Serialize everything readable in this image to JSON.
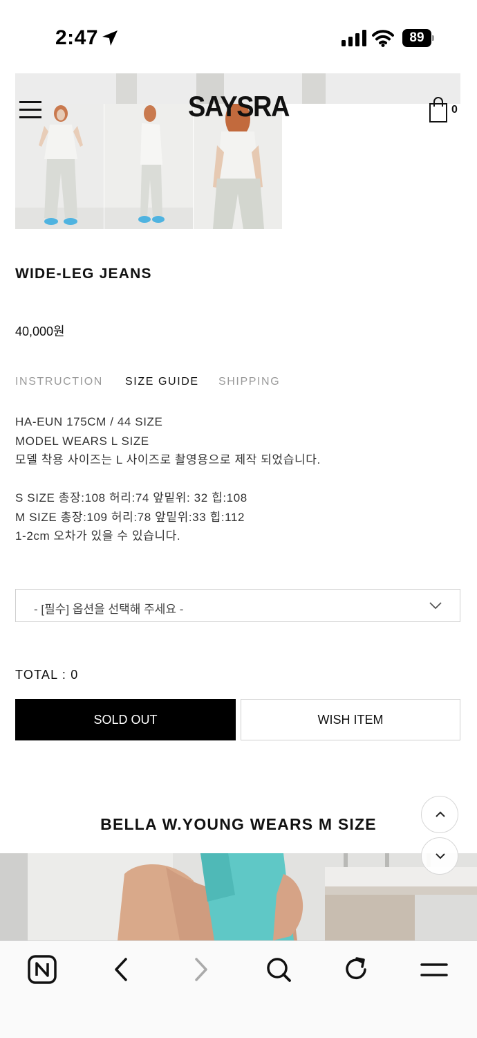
{
  "status_bar": {
    "time": "2:47",
    "battery": "89",
    "icons": [
      "location-arrow-icon",
      "cellular-signal-icon",
      "wifi-icon",
      "battery-icon"
    ]
  },
  "header": {
    "logo": "SAYSRA",
    "cart_count": "0",
    "icons": [
      "hamburger-menu-icon",
      "shopping-bag-icon"
    ]
  },
  "product": {
    "title": "WIDE-LEG JEANS",
    "price": "40,000원"
  },
  "tabs": [
    {
      "label": "INSTRUCTION",
      "active": false
    },
    {
      "label": "SIZE GUIDE",
      "active": true
    },
    {
      "label": "SHIPPING",
      "active": false
    }
  ],
  "size_guide": {
    "lines": [
      "HA-EUN 175CM / 44 SIZE",
      "MODEL WEARS L SIZE",
      "모델 착용 사이즈는 L 사이즈로 촬영용으로 제작 되었습니다.",
      "",
      "S SIZE 총장:108 허리:74 앞밑위: 32 힙:108",
      "M SIZE 총장:109 허리:78 앞밑위:33 힙:112",
      "1-2cm 오차가 있을 수 있습니다."
    ]
  },
  "option_select": {
    "placeholder": "- [필수] 옵션을 선택해 주세요 -"
  },
  "total": {
    "label": "TOTAL : 0"
  },
  "buttons": {
    "sold_out": "SOLD OUT",
    "wish_item": "WISH ITEM"
  },
  "section": {
    "title": "BELLA W.YOUNG WEARS M SIZE"
  },
  "colors": {
    "accent": "#000000",
    "muted_text": "#999999",
    "border": "#cfcfcf"
  },
  "bottom_nav": {
    "icons": [
      "naver-n-icon",
      "back-arrow-icon",
      "forward-arrow-icon",
      "search-icon",
      "refresh-icon",
      "menu-icon"
    ]
  }
}
